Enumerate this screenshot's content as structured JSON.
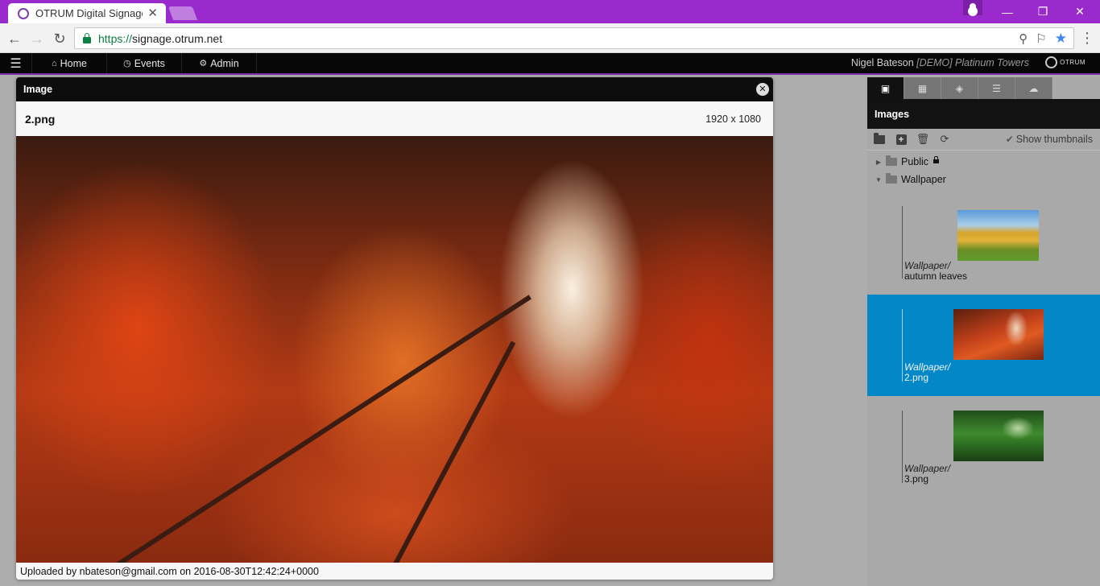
{
  "browser": {
    "tab_title": "OTRUM Digital Signage -",
    "url_protocol": "https://",
    "url_host": "signage.otrum.net"
  },
  "app": {
    "nav": [
      {
        "label": "Home",
        "icon": "home-icon"
      },
      {
        "label": "Events",
        "icon": "clock-icon"
      },
      {
        "label": "Admin",
        "icon": "cogs-icon"
      }
    ],
    "user_name": "Nigel Bateson",
    "user_org": "[DEMO] Platinum Towers",
    "brand": "OTRUM"
  },
  "dialog": {
    "title": "Image",
    "filename": "2.png",
    "dimensions": "1920 x 1080",
    "footer": "Uploaded by nbateson@gmail.com on 2016-08-30T12:42:24+0000"
  },
  "panel": {
    "tabs": [
      {
        "icon": "image-icon",
        "active": true
      },
      {
        "icon": "film-icon",
        "active": false
      },
      {
        "icon": "cube-icon",
        "active": false
      },
      {
        "icon": "list-icon",
        "active": false
      },
      {
        "icon": "cloud-download-icon",
        "active": false
      }
    ],
    "title": "Images",
    "show_thumbnails_label": "Show thumbnails",
    "show_thumbnails_checked": true,
    "folders": [
      {
        "name": "Public",
        "expanded": false,
        "locked": true
      },
      {
        "name": "Wallpaper",
        "expanded": true,
        "locked": false
      }
    ],
    "items": [
      {
        "dir": "Wallpaper/",
        "name": "autumn leaves",
        "selected": false
      },
      {
        "dir": "Wallpaper/",
        "name": "2.png",
        "selected": true
      },
      {
        "dir": "Wallpaper/",
        "name": "3.png",
        "selected": false
      }
    ],
    "selected_color": "#0288c6"
  }
}
